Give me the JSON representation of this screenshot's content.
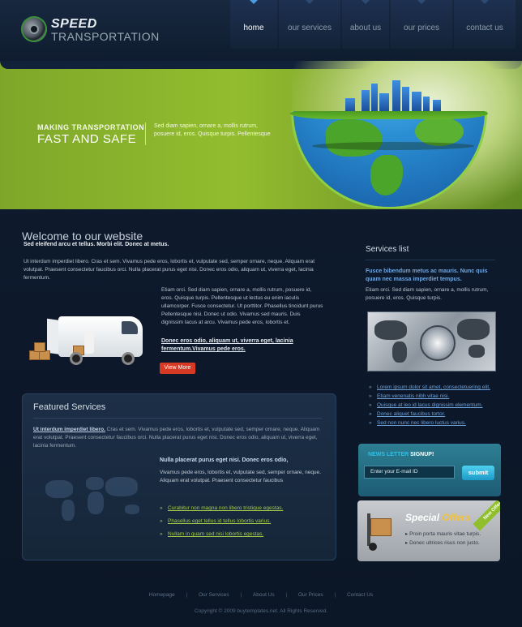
{
  "logo": {
    "top": "SPEED",
    "bottom": "TRANSPORTATION"
  },
  "nav": [
    "home",
    "our services",
    "about us",
    "our prices",
    "contact us"
  ],
  "hero": {
    "kicker": "MAKING TRANSPORTATION",
    "title": "FAST AND SAFE",
    "text": "Sed diam sapien, ornare a, mollis rutrum, posuere id, eros. Quisque turpis. Pellentesque"
  },
  "welcome": {
    "title": "Welcome to our website",
    "subtitle": "Sed eleifend arcu et tellus. Morbi elit. Donec at metus.",
    "para1": "Ut interdum imperdiet libero. Cras et sem. Vivamus pede eros, lobortis et, vulputate sed, semper ornare, neque. Aliquam erat volutpat. Praesent consectetur faucibus orci. Nulla placerat purus eget nisi. Donec eros odio, aliquam ut, viverra eget, lacinia fermentum.",
    "para2": "Etiam orci. Sed diam sapien, ornare a, mollis rutrum, posuere id, eros. Quisque turpis. Pellentesque ut lectus eu enim iaculis ullamcorper. Fusce consectetur. Ut porttitor. Phasellus tincidunt purus Pellentesque nisi. Donec ut odio. Vivamus sed mauris. Duis dignissim lacus at arcu. Vivamus pede eros, lobortis et.",
    "link": "Donec eros odio, aliquam ut, viverra eget, lacinia fermentum.Vivamus pede eros.",
    "button": "View More"
  },
  "featured": {
    "title": "Featured Services",
    "lead_link": "Ut interdum imperdiet libero.",
    "para": "Cras et sem. Vivamus pede eros, lobortis et, vulputate sed, semper ornare, neque. Aliquam erat volutpat. Praesent consectetur faucibus orci. Nulla placerat purus eget nisi. Donec eros odio, aliquam ut, viverra eget, lacinia fermentum.",
    "heading": "Nulla placerat purus eget nisi. Donec eros odio,",
    "para2": "Vivamus pede eros, lobortis et, vulputate sed, semper ornare, neque. Aliquam erat volutpat. Praesent consectetur faucibus",
    "list": [
      "Curabitur non magna non libero tristique egestas.",
      "Phasellus eget tellus id tellus lobortis varius.",
      "Nullam in quam sed nisi lobortis egestas."
    ]
  },
  "services": {
    "title": "Services list",
    "heading": "Fusce bibendum metus ac mauris. Nunc quis quam nec massa imperdiet tempus.",
    "text": "Etiam orci. Sed diam sapien, ornare a, mollis rutrum, posuere id, eros. Quisque turpis.",
    "list": [
      "Lorem ipsum dolor sit amet, consectetuering elit.",
      "Etiam venenatis nibh vitae nisi.",
      "Quisque at leo id lacus dignissim elementum.",
      "Donec aliquet faucibus tortor.",
      "Sed non nunc nec libero luctus varius."
    ]
  },
  "newsletter": {
    "title_prefix": "NEWS LETTER",
    "title_suffix": "SIGNUP!",
    "input_placeholder": "Enter your E-mail ID",
    "button": "submit"
  },
  "special": {
    "title_prefix": "Special",
    "title_suffix": "Offers",
    "ribbon": "New Offers",
    "items": [
      "Proin porta mauris vitae turpis.",
      "Donec ultrices risus non justo."
    ]
  },
  "footer": {
    "links": [
      "Homepage",
      "Our Services",
      "About Us",
      "Our Prices",
      "Contact Us"
    ],
    "separator": "|",
    "copyright": "Copyright © 2009 buytemplates.net. All Rights Reserved."
  }
}
